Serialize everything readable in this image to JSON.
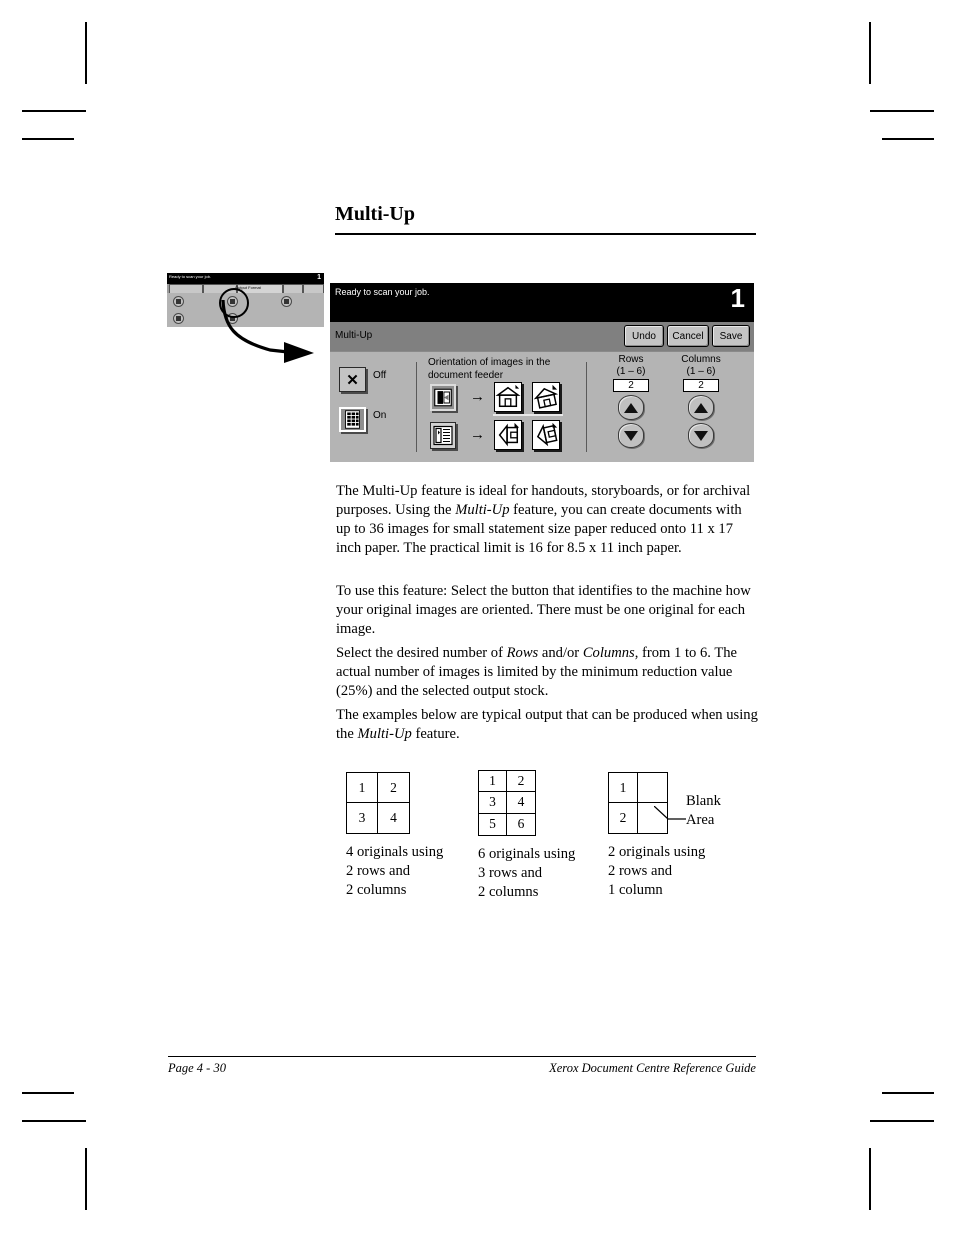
{
  "page": {
    "title": "Multi-Up",
    "footer_left": "Page 4 - 30",
    "footer_right": "Xerox Document Centre Reference Guide"
  },
  "thumbnail": {
    "status_text": "Ready to scan your job.",
    "status_number": "1",
    "tab_label": "Output Format",
    "highlight_icon": "circled-button-highlight",
    "callout_icon": "curved-arrow-icon"
  },
  "console": {
    "status_text": "Ready to scan your job.",
    "status_number": "1",
    "toolbar": {
      "title": "Multi-Up",
      "undo_label": "Undo",
      "cancel_label": "Cancel",
      "save_label": "Save"
    },
    "toggle": {
      "off_label": "Off",
      "on_label": "On",
      "off_icon": "x-icon",
      "on_icon": "multi-up-grid-icon",
      "selected": "On"
    },
    "orientation": {
      "label": "Orientation of images in the document feeder",
      "rows": [
        {
          "feeder_icon": "document-feeder-landscape-icon",
          "arrow_icon": "right-arrow-icon",
          "result_icons": [
            "page-house-upright-icon",
            "page-house-rotated-icon"
          ],
          "selected": true
        },
        {
          "feeder_icon": "document-feeder-portrait-icon",
          "arrow_icon": "right-arrow-icon",
          "result_icons": [
            "page-house-sideways-icon",
            "page-house-sideways-rotated-icon"
          ],
          "selected": false
        }
      ]
    },
    "steppers": [
      {
        "title": "Rows",
        "range": "(1 – 6)",
        "value": "2",
        "up_icon": "triangle-up-icon",
        "down_icon": "triangle-down-icon"
      },
      {
        "title": "Columns",
        "range": "(1 – 6)",
        "value": "2",
        "up_icon": "triangle-up-icon",
        "down_icon": "triangle-down-icon"
      }
    ],
    "colors": {
      "panel_gray": "#b4b4b4",
      "toolbar_gray": "#808080",
      "status_black": "#000000",
      "button_gray": "#c4c4c4"
    }
  },
  "body": {
    "para_1_pre": "The Multi-Up feature is ideal for handouts, storyboards, or for archival purposes. Using the ",
    "para_1_em": "Multi-Up",
    "para_1_post": " feature, you can create documents with up to 36 images for small statement size paper reduced onto 11 x 17 inch paper. The practical limit is 16 for 8.5 x 11 inch paper.",
    "para_2": "To use this feature: Select the button that identifies to the machine how your original images are oriented. There must be one original for each image.",
    "para_3_pre": "Select the desired number of ",
    "para_3_em1": "Rows",
    "para_3_mid": " and/or ",
    "para_3_em2": "Columns",
    "para_3_post": ", from 1 to 6. The actual number of images is limited by the minimum reduction value (25%) and the selected output stock.",
    "para_4_pre": "The examples below are typical output that can be produced when using the ",
    "para_4_em": "Multi-Up",
    "para_4_post": " feature."
  },
  "examples": [
    {
      "cells": [
        "1",
        "2",
        "3",
        "4"
      ],
      "rows": 2,
      "cols": 2,
      "caption": "4 originals using\n2 rows and\n2 columns"
    },
    {
      "cells": [
        "1",
        "2",
        "3",
        "4",
        "5",
        "6"
      ],
      "rows": 3,
      "cols": 2,
      "caption": "6 originals using\n3 rows and\n2 columns"
    },
    {
      "cells": [
        "1",
        "",
        "2",
        ""
      ],
      "rows": 2,
      "cols": 2,
      "caption": "2 originals using\n2 rows and\n1 column",
      "annotation": "Blank\nArea"
    }
  ]
}
